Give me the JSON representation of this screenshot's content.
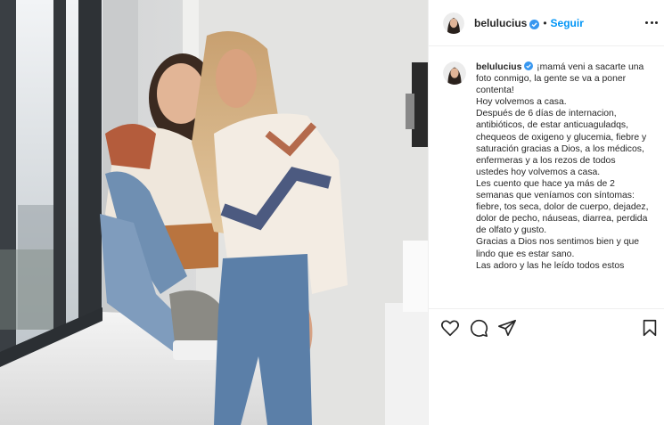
{
  "post": {
    "username": "belulucius",
    "follow_label": "Seguir",
    "separator": "•",
    "verified": true
  },
  "caption": {
    "username": "belulucius",
    "lines": [
      "¡mamá veni a sacarte una foto conmigo, la gente se va a poner contenta!",
      "Hoy volvemos a casa.",
      "Después de 6 días de internacion, antibióticos, de estar anticuaguladqs, chequeos de oxigeno y glucemia, fiebre y saturación gracias a Dios, a los médicos, enfermeras y a los rezos de todos ustedes hoy volvemos a casa.",
      "Les cuento que hace ya más de 2 semanas que veníamos con síntomas: fiebre, tos seca, dolor de cuerpo, dejadez, dolor de pecho, náuseas, diarrea, perdida de olfato y gusto.",
      "Gracias a Dios nos sentimos bien y que lindo que es estar sano.",
      "Las adoro y las he leído todos estos"
    ]
  },
  "actions": {
    "icons": [
      "heart-icon",
      "comment-icon",
      "share-icon",
      "bookmark-icon"
    ]
  },
  "colors": {
    "accent": "#0095f6",
    "text": "#262626",
    "border": "#efefef"
  }
}
